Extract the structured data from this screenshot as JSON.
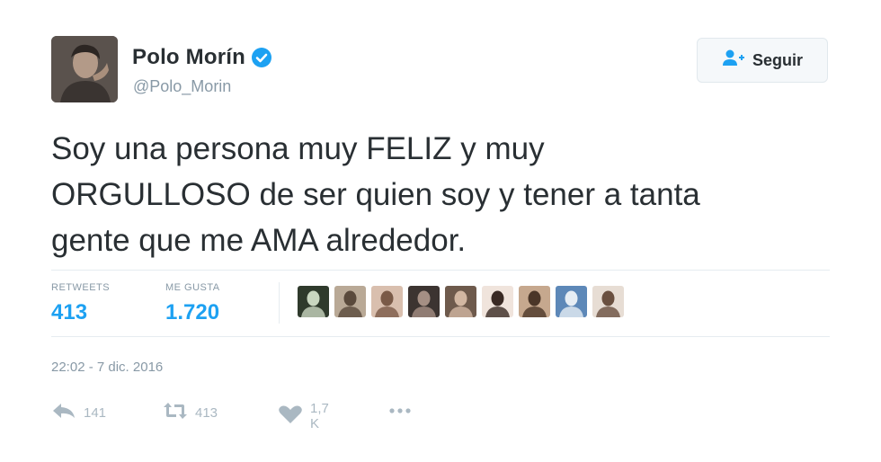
{
  "user": {
    "display_name": "Polo Morín",
    "handle": "@Polo_Morin",
    "verified": true,
    "verified_icon": "verified-badge-icon"
  },
  "follow_button": {
    "label": "Seguir",
    "icon": "follow-user-icon"
  },
  "tweet": {
    "line1": "Soy una persona muy FELIZ y muy",
    "line2": "ORGULLOSO de ser quien soy y tener a tanta",
    "line3": "gente que me AMA alrededor."
  },
  "stats": {
    "retweets_label": "RETWEETS",
    "retweets_value": "413",
    "likes_label": "ME GUSTA",
    "likes_value": "1.720"
  },
  "likers": [
    {
      "name": "liker-avatar-1",
      "bg": "#2f3a2c",
      "fg": "#c9d6c0"
    },
    {
      "name": "liker-avatar-2",
      "bg": "#b9a996",
      "fg": "#5a4a3c"
    },
    {
      "name": "liker-avatar-3",
      "bg": "#d9bfae",
      "fg": "#7a5a47"
    },
    {
      "name": "liker-avatar-4",
      "bg": "#3c3431",
      "fg": "#a58f84"
    },
    {
      "name": "liker-avatar-5",
      "bg": "#6e5a4c",
      "fg": "#d2b7a2"
    },
    {
      "name": "liker-avatar-6",
      "bg": "#f0e4dc",
      "fg": "#3a2a24"
    },
    {
      "name": "liker-avatar-7",
      "bg": "#c6a88e",
      "fg": "#4b3628"
    },
    {
      "name": "liker-avatar-8",
      "bg": "#5d88b8",
      "fg": "#e6edf4"
    },
    {
      "name": "liker-avatar-9",
      "bg": "#e7ddd4",
      "fg": "#6a5040"
    }
  ],
  "timestamp": "22:02 - 7 dic. 2016",
  "actions": {
    "reply_count": "141",
    "retweet_count": "413",
    "like_count": "1,7 K",
    "reply_icon": "reply-icon",
    "retweet_icon": "retweet-icon",
    "like_icon": "heart-icon",
    "more_icon": "more-dots-icon"
  },
  "colors": {
    "accent": "#1da1f2",
    "text": "#292f33",
    "muted": "#8899a6",
    "divider": "#e6ecf0"
  }
}
